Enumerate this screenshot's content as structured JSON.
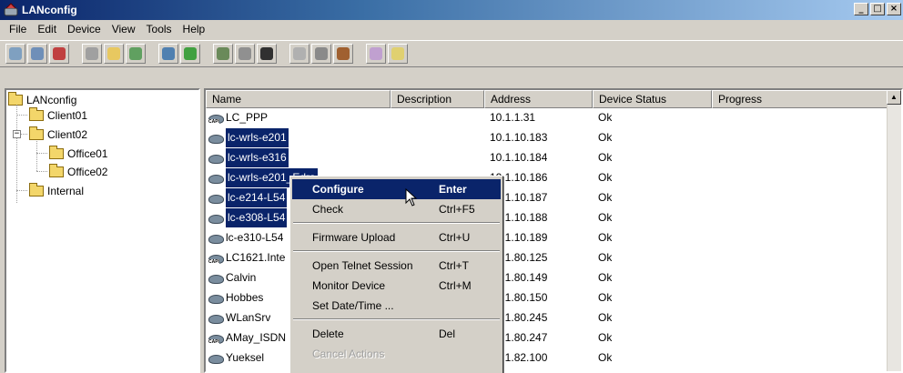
{
  "window": {
    "title": "LANconfig",
    "controls": [
      "_",
      "□",
      "×"
    ]
  },
  "menu": [
    "File",
    "Edit",
    "Device",
    "View",
    "Tools",
    "Help"
  ],
  "toolbar_icons": [
    "open-device-icon",
    "find-device-icon",
    "remove-device-icon",
    "print-icon",
    "new-folder-icon",
    "properties-icon",
    "configure-icon",
    "check-icon",
    "firmware-icon",
    "telnet-icon",
    "monitor-icon",
    "wizard-icon",
    "settings-icon",
    "log-icon",
    "help-icon",
    "help-pointer-icon"
  ],
  "tree": {
    "root": "LANconfig",
    "items": [
      {
        "label": "Client01",
        "level": 1
      },
      {
        "label": "Client02",
        "level": 1,
        "expanded": true
      },
      {
        "label": "Office01",
        "level": 2
      },
      {
        "label": "Office02",
        "level": 2
      },
      {
        "label": "Internal",
        "level": 1
      }
    ]
  },
  "list": {
    "columns": [
      "Name",
      "Description",
      "Address",
      "Device Status",
      "Progress"
    ],
    "rows": [
      {
        "name": "LC_PPP",
        "address": "10.1.1.31",
        "status": "Ok",
        "capi": true,
        "selected": false
      },
      {
        "name": "lc-wrls-e201",
        "address": "10.1.10.183",
        "status": "Ok",
        "capi": false,
        "selected": true
      },
      {
        "name": "lc-wrls-e316",
        "address": "10.1.10.184",
        "status": "Ok",
        "capi": false,
        "selected": true
      },
      {
        "name": "lc-wrls-e201_Edra",
        "address": "10.1.10.186",
        "status": "Ok",
        "capi": false,
        "selected": true
      },
      {
        "name": "lc-e214-L54",
        "address": "10.1.10.187",
        "status": "Ok",
        "capi": false,
        "selected": true
      },
      {
        "name": "lc-e308-L54",
        "address": "10.1.10.188",
        "status": "Ok",
        "capi": false,
        "selected": true
      },
      {
        "name": "lc-e310-L54",
        "address": "10.1.10.189",
        "status": "Ok",
        "capi": false,
        "selected": false
      },
      {
        "name": "LC1621.Inte",
        "address": "10.1.80.125",
        "status": "Ok",
        "capi": true,
        "selected": false
      },
      {
        "name": "Calvin",
        "address": "10.1.80.149",
        "status": "Ok",
        "capi": false,
        "selected": false
      },
      {
        "name": "Hobbes",
        "address": "10.1.80.150",
        "status": "Ok",
        "capi": false,
        "selected": false
      },
      {
        "name": "WLanSrv",
        "address": "10.1.80.245",
        "status": "Ok",
        "capi": false,
        "selected": false
      },
      {
        "name": "AMay_ISDN",
        "address": "10.1.80.247",
        "status": "Ok",
        "capi": true,
        "selected": false
      },
      {
        "name": "Yueksel",
        "address": "10.1.82.100",
        "status": "Ok",
        "capi": false,
        "selected": false
      }
    ]
  },
  "context_menu": {
    "items": [
      {
        "label": "Configure",
        "accel": "Enter",
        "highlighted": true
      },
      {
        "label": "Check",
        "accel": "Ctrl+F5"
      },
      {
        "sep": true
      },
      {
        "label": "Firmware Upload",
        "accel": "Ctrl+U"
      },
      {
        "sep": true
      },
      {
        "label": "Open Telnet Session",
        "accel": "Ctrl+T"
      },
      {
        "label": "Monitor Device",
        "accel": "Ctrl+M"
      },
      {
        "label": "Set Date/Time ...",
        "accel": ""
      },
      {
        "sep": true
      },
      {
        "label": "Delete",
        "accel": "Del"
      },
      {
        "label": "Cancel Actions",
        "accel": "",
        "disabled": true
      }
    ]
  },
  "colors": {
    "selection": "#0a246a",
    "face": "#d4d0c8"
  }
}
